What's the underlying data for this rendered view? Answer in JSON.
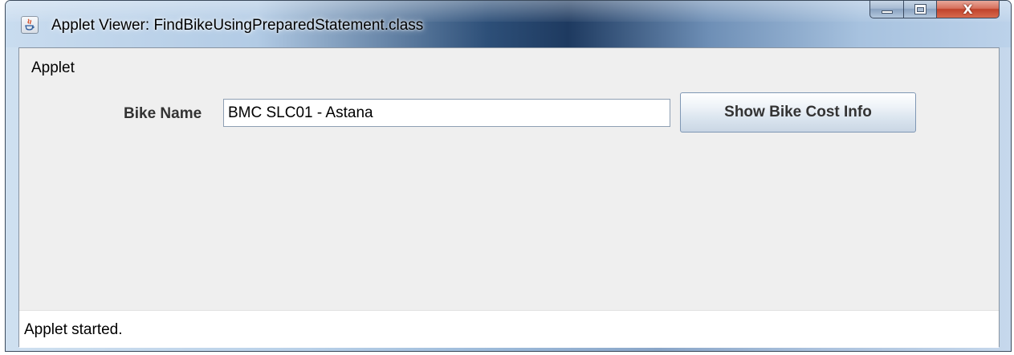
{
  "window": {
    "title": "Applet Viewer: FindBikeUsingPreparedStatement.class",
    "app_icon": "java-icon",
    "controls": {
      "minimize_icon": "minimize-icon",
      "maximize_icon": "maximize-icon",
      "close_icon": "close-icon",
      "close_glyph": "X"
    }
  },
  "menubar": {
    "items": [
      {
        "label": "Applet"
      }
    ]
  },
  "form": {
    "bike_name_label": "Bike Name",
    "bike_name_value": "BMC SLC01 - Astana",
    "show_button_label": "Show Bike Cost Info"
  },
  "status": {
    "text": "Applet started."
  },
  "colors": {
    "client_background": "#efefef",
    "status_background": "#ffffff",
    "close_button": "#c0432c"
  }
}
